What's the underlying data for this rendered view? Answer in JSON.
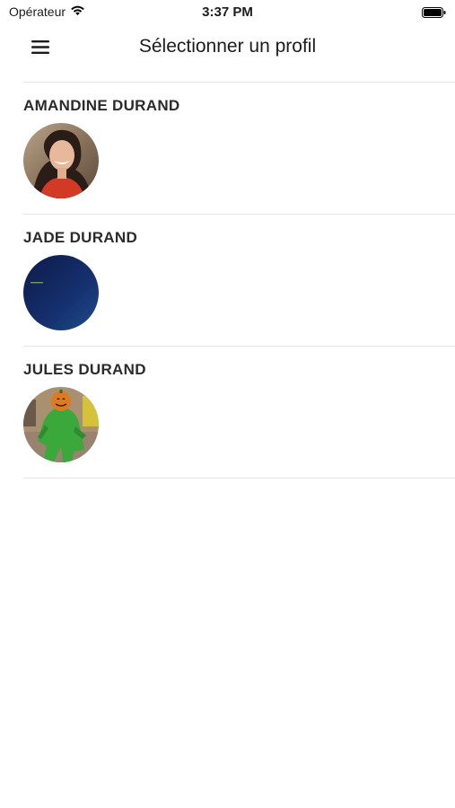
{
  "status_bar": {
    "carrier": "Opérateur",
    "time": "3:37 PM",
    "wifi_icon": "wifi-icon",
    "battery_icon": "battery-icon"
  },
  "nav": {
    "title": "Sélectionner un profil",
    "menu_icon": "hamburger-menu-icon"
  },
  "profiles": [
    {
      "name": "AMANDINE DURAND",
      "avatar": "woman-photo-avatar"
    },
    {
      "name": "JADE DURAND",
      "avatar": "dark-blue-avatar"
    },
    {
      "name": "JULES DURAND",
      "avatar": "pumpkin-costume-avatar"
    }
  ],
  "colors": {
    "text": "#2b2b2b",
    "divider": "#e6e6e6",
    "background": "#ffffff"
  }
}
